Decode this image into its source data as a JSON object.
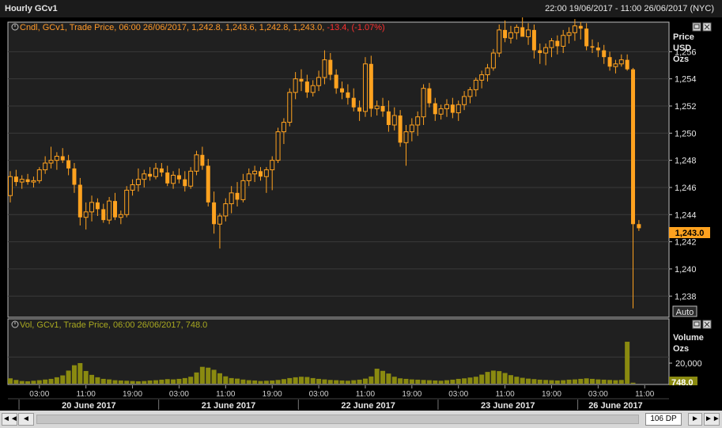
{
  "window": {
    "title": "Hourly GCv1",
    "range": "22:00 19/06/2017 - 11:00 26/06/2017 (NYC)"
  },
  "price_panel": {
    "legend": {
      "prefix": "Cndl, GCv1, Trade Price, 06:00 26/06/2017, 1,242.8, 1,243.6, 1,242.8, 1,243.0, ",
      "change": "-13.4, (-1.07%)",
      "change_color": "#ff3030"
    },
    "axis_title": [
      "Price",
      "USD",
      "Ozs"
    ],
    "last_price_label": "1,243.0",
    "auto_label": "Auto"
  },
  "volume_panel": {
    "legend": "Vol, GCv1, Trade Price, 06:00 26/06/2017, 748.0",
    "axis_title": [
      "Volume",
      "Ozs"
    ],
    "tick_label": "20,000",
    "last_value_label": "748.0"
  },
  "time_axis": {
    "hour_labels": [
      "03:00",
      "11:00",
      "19:00",
      "03:00",
      "11:00",
      "19:00",
      "03:00",
      "11:00",
      "19:00",
      "03:00",
      "11:00",
      "19:00",
      "03:00",
      "11:00"
    ],
    "day_labels": [
      "20 June 2017",
      "21 June 2017",
      "22 June 2017",
      "23 June 2017",
      "26 June 2017"
    ]
  },
  "nav": {
    "first": "◄◄",
    "prev": "◄",
    "zoom": "106 DP",
    "next": "►",
    "last": "►►"
  },
  "colors": {
    "background": "#000000",
    "plot_bg": "#202020",
    "grid": "#3a3a3a",
    "candle": "#ffa21f",
    "volume": "#8a8a10",
    "legend_text": "#ff9a2a",
    "volume_legend_text": "#a8a820"
  },
  "chart_data": [
    {
      "type": "candlestick",
      "title": "Cndl, GCv1, Trade Price",
      "ylabel": "Price USD Ozs",
      "ylim": [
        1236.5,
        1258.0
      ],
      "yticks": [
        1238,
        1240,
        1242,
        1244,
        1246,
        1248,
        1250,
        1252,
        1254,
        1256
      ],
      "ytick_labels": [
        "1,238",
        "1,240",
        "1,242",
        "1,244",
        "1,246",
        "1,248",
        "1,250",
        "1,252",
        "1,254",
        "1,256"
      ],
      "last": 1243.0,
      "ohlc": [
        [
          1245.4,
          1247.2,
          1244.9,
          1246.8
        ],
        [
          1246.8,
          1247.3,
          1246.1,
          1246.4
        ],
        [
          1246.4,
          1246.9,
          1245.9,
          1246.6
        ],
        [
          1246.6,
          1247.0,
          1246.2,
          1246.4
        ],
        [
          1246.4,
          1246.8,
          1246.0,
          1246.5
        ],
        [
          1246.5,
          1247.5,
          1246.3,
          1247.3
        ],
        [
          1247.3,
          1248.3,
          1247.0,
          1247.8
        ],
        [
          1247.8,
          1249.0,
          1247.4,
          1248.0
        ],
        [
          1248.0,
          1248.6,
          1247.3,
          1248.3
        ],
        [
          1248.3,
          1248.9,
          1247.8,
          1248.0
        ],
        [
          1248.0,
          1248.4,
          1246.9,
          1247.4
        ],
        [
          1247.4,
          1247.8,
          1245.6,
          1246.2
        ],
        [
          1246.2,
          1246.7,
          1243.2,
          1243.8
        ],
        [
          1243.8,
          1244.9,
          1242.9,
          1244.2
        ],
        [
          1244.2,
          1245.4,
          1243.5,
          1244.9
        ],
        [
          1244.9,
          1245.2,
          1243.9,
          1244.4
        ],
        [
          1244.4,
          1244.8,
          1243.4,
          1243.6
        ],
        [
          1243.6,
          1245.3,
          1243.3,
          1245.0
        ],
        [
          1245.0,
          1245.6,
          1243.6,
          1243.8
        ],
        [
          1243.8,
          1244.3,
          1243.3,
          1244.0
        ],
        [
          1244.0,
          1246.1,
          1243.8,
          1245.8
        ],
        [
          1245.8,
          1246.6,
          1245.4,
          1246.2
        ],
        [
          1246.2,
          1247.4,
          1245.7,
          1246.6
        ],
        [
          1246.6,
          1247.3,
          1246.0,
          1247.0
        ],
        [
          1247.0,
          1247.5,
          1246.5,
          1246.8
        ],
        [
          1246.8,
          1247.8,
          1246.6,
          1247.4
        ],
        [
          1247.4,
          1247.8,
          1246.8,
          1247.1
        ],
        [
          1247.1,
          1247.6,
          1246.1,
          1246.3
        ],
        [
          1246.3,
          1247.2,
          1245.9,
          1246.9
        ],
        [
          1246.9,
          1247.4,
          1246.3,
          1246.6
        ],
        [
          1246.6,
          1247.2,
          1245.7,
          1246.1
        ],
        [
          1246.1,
          1247.5,
          1245.9,
          1247.2
        ],
        [
          1247.2,
          1248.7,
          1246.9,
          1248.4
        ],
        [
          1248.4,
          1249.0,
          1247.3,
          1247.6
        ],
        [
          1247.6,
          1248.1,
          1244.6,
          1244.9
        ],
        [
          1244.9,
          1245.7,
          1242.6,
          1243.3
        ],
        [
          1243.3,
          1244.1,
          1241.5,
          1243.9
        ],
        [
          1243.9,
          1245.2,
          1243.5,
          1244.8
        ],
        [
          1244.8,
          1246.1,
          1244.1,
          1245.6
        ],
        [
          1245.6,
          1246.4,
          1244.6,
          1245.1
        ],
        [
          1245.1,
          1247.0,
          1244.9,
          1246.5
        ],
        [
          1246.5,
          1247.4,
          1246.1,
          1247.0
        ],
        [
          1247.0,
          1247.6,
          1246.4,
          1247.2
        ],
        [
          1247.2,
          1247.5,
          1246.5,
          1246.8
        ],
        [
          1246.8,
          1247.5,
          1245.6,
          1247.3
        ],
        [
          1247.3,
          1248.3,
          1245.8,
          1248.0
        ],
        [
          1248.0,
          1250.4,
          1247.8,
          1250.1
        ],
        [
          1250.1,
          1251.1,
          1249.2,
          1250.8
        ],
        [
          1250.8,
          1253.3,
          1250.5,
          1253.0
        ],
        [
          1253.0,
          1254.5,
          1252.5,
          1254.0
        ],
        [
          1254.0,
          1254.7,
          1253.1,
          1253.8
        ],
        [
          1253.8,
          1254.3,
          1252.6,
          1253.0
        ],
        [
          1253.0,
          1253.9,
          1252.7,
          1253.5
        ],
        [
          1253.5,
          1254.6,
          1253.1,
          1254.1
        ],
        [
          1254.1,
          1256.1,
          1253.6,
          1255.4
        ],
        [
          1255.4,
          1255.9,
          1253.9,
          1254.3
        ],
        [
          1254.3,
          1254.7,
          1252.9,
          1253.3
        ],
        [
          1253.3,
          1253.8,
          1252.5,
          1253.0
        ],
        [
          1253.0,
          1253.6,
          1252.1,
          1252.6
        ],
        [
          1252.6,
          1253.3,
          1251.6,
          1251.9
        ],
        [
          1251.9,
          1252.4,
          1250.9,
          1251.6
        ],
        [
          1251.6,
          1255.6,
          1251.2,
          1255.1
        ],
        [
          1255.1,
          1255.7,
          1251.2,
          1251.8
        ],
        [
          1251.8,
          1252.4,
          1251.3,
          1252.0
        ],
        [
          1252.0,
          1252.6,
          1251.2,
          1251.6
        ],
        [
          1251.6,
          1252.4,
          1250.1,
          1250.6
        ],
        [
          1250.6,
          1251.9,
          1250.2,
          1251.3
        ],
        [
          1251.3,
          1251.7,
          1249.0,
          1249.3
        ],
        [
          1249.3,
          1250.6,
          1247.6,
          1250.1
        ],
        [
          1250.1,
          1251.1,
          1249.4,
          1250.6
        ],
        [
          1250.6,
          1251.6,
          1249.8,
          1251.2
        ],
        [
          1251.2,
          1253.6,
          1250.6,
          1253.3
        ],
        [
          1253.3,
          1253.7,
          1251.9,
          1252.2
        ],
        [
          1252.2,
          1252.6,
          1250.9,
          1251.4
        ],
        [
          1251.4,
          1252.1,
          1251.0,
          1251.8
        ],
        [
          1251.8,
          1252.5,
          1251.2,
          1252.1
        ],
        [
          1252.1,
          1252.6,
          1251.1,
          1251.5
        ],
        [
          1251.5,
          1252.4,
          1250.9,
          1252.1
        ],
        [
          1252.1,
          1253.1,
          1251.7,
          1252.7
        ],
        [
          1252.7,
          1253.4,
          1252.2,
          1253.2
        ],
        [
          1253.2,
          1254.1,
          1252.7,
          1253.9
        ],
        [
          1253.9,
          1254.6,
          1253.3,
          1254.3
        ],
        [
          1254.3,
          1255.1,
          1253.8,
          1254.8
        ],
        [
          1254.8,
          1256.2,
          1254.6,
          1255.9
        ],
        [
          1255.9,
          1258.0,
          1255.6,
          1257.6
        ],
        [
          1257.6,
          1258.3,
          1256.7,
          1257.0
        ],
        [
          1257.0,
          1257.9,
          1256.6,
          1257.4
        ],
        [
          1257.4,
          1258.0,
          1256.9,
          1257.8
        ],
        [
          1257.8,
          1259.4,
          1257.3,
          1257.1
        ],
        [
          1257.1,
          1258.1,
          1256.5,
          1257.6
        ],
        [
          1257.6,
          1258.0,
          1255.5,
          1256.1
        ],
        [
          1256.1,
          1256.6,
          1255.1,
          1255.9
        ],
        [
          1255.9,
          1256.6,
          1255.0,
          1256.3
        ],
        [
          1256.3,
          1257.0,
          1255.6,
          1256.8
        ],
        [
          1256.8,
          1257.2,
          1255.8,
          1256.4
        ],
        [
          1256.4,
          1257.6,
          1255.9,
          1257.2
        ],
        [
          1257.2,
          1257.8,
          1256.6,
          1257.4
        ],
        [
          1257.4,
          1258.4,
          1256.8,
          1257.9
        ],
        [
          1257.9,
          1258.2,
          1256.9,
          1257.7
        ],
        [
          1257.7,
          1258.1,
          1256.1,
          1256.4
        ],
        [
          1256.4,
          1256.9,
          1255.9,
          1256.3
        ],
        [
          1256.3,
          1256.7,
          1255.6,
          1256.1
        ],
        [
          1256.1,
          1256.5,
          1255.1,
          1255.6
        ],
        [
          1255.6,
          1256.0,
          1254.6,
          1254.9
        ],
        [
          1254.9,
          1255.4,
          1254.4,
          1255.1
        ],
        [
          1255.1,
          1255.8,
          1254.9,
          1255.4
        ],
        [
          1255.4,
          1255.8,
          1254.6,
          1254.7
        ],
        [
          1254.7,
          1254.8,
          1237.1,
          1243.3
        ],
        [
          1243.3,
          1243.6,
          1242.8,
          1243.0
        ]
      ]
    },
    {
      "type": "bar",
      "title": "Vol, GCv1, Trade Price",
      "ylabel": "Volume Ozs",
      "ylim": [
        0,
        42000
      ],
      "yticks": [
        20000
      ],
      "last": 748.0,
      "values": [
        4000,
        2800,
        2000,
        1800,
        2200,
        2600,
        3100,
        3600,
        4800,
        6200,
        9800,
        13800,
        15400,
        9500,
        6600,
        4800,
        3600,
        3200,
        2600,
        2400,
        2200,
        2000,
        1800,
        2000,
        2400,
        2600,
        3000,
        3400,
        3200,
        3600,
        4200,
        5200,
        8400,
        12600,
        12000,
        10400,
        7800,
        5500,
        4200,
        3800,
        3100,
        2600,
        2400,
        2000,
        2200,
        2400,
        2800,
        3400,
        4200,
        4800,
        5200,
        5000,
        4200,
        3600,
        3200,
        2800,
        2600,
        2400,
        2200,
        2600,
        3000,
        3800,
        5400,
        11200,
        9600,
        7600,
        5200,
        4000,
        3600,
        3200,
        3000,
        2800,
        2600,
        2400,
        2200,
        2600,
        3000,
        3600,
        4000,
        4600,
        5200,
        6800,
        8800,
        9800,
        9400,
        8000,
        6400,
        5200,
        4400,
        3800,
        3400,
        3000,
        2800,
        2600,
        2400,
        2600,
        3000,
        3200,
        3600,
        4000,
        3600,
        3200,
        3000,
        2800,
        2600,
        2800,
        31400,
        748
      ]
    }
  ]
}
